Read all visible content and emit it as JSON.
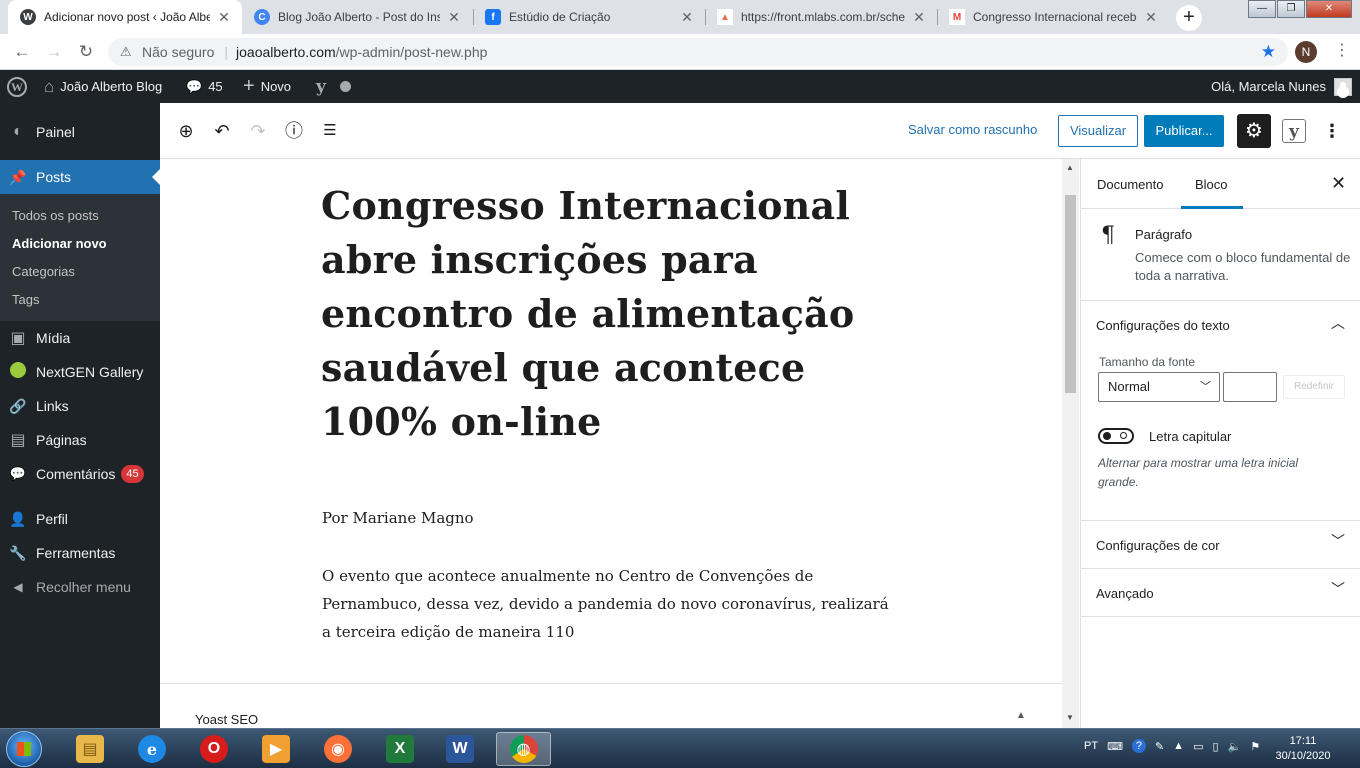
{
  "browser": {
    "tabs": [
      {
        "title": "Adicionar novo post ‹ João Albe",
        "favicon_color": "#3c4043",
        "favicon_letter": "W",
        "active": true
      },
      {
        "title": "Blog João Alberto - Post do Inst",
        "favicon_color": "#4285f4",
        "favicon_letter": "C",
        "active": false
      },
      {
        "title": "Estúdio de Criação",
        "favicon_color": "#1877f2",
        "favicon_letter": "f",
        "active": false
      },
      {
        "title": "https://front.mlabs.com.br/sche",
        "favicon_color": "#f4a261",
        "favicon_letter": "▲",
        "active": false
      },
      {
        "title": "Congresso Internacional recebe",
        "favicon_color": "#ea4335",
        "favicon_letter": "M",
        "active": false
      }
    ],
    "tab_close": "✕",
    "new_tab": "+",
    "window_controls": {
      "minimize": "—",
      "maximize": "❐",
      "close": "✕"
    },
    "nav": {
      "back": "←",
      "forward": "→",
      "reload": "↻"
    },
    "security_icon": "⚠",
    "security_text": "Não seguro",
    "url_host": "joaoalberto.com",
    "url_path": "/wp-admin/post-new.php",
    "bookmark_icon": "★",
    "profile_initial": "N",
    "menu_icon": "⋮"
  },
  "adminbar": {
    "wp_logo": "W",
    "site_icon": "⌂",
    "site_name": "João Alberto Blog",
    "comments_icon": "💬",
    "comments_count": "45",
    "new_icon": "+",
    "new_label": "Novo",
    "yoast_icon": "y",
    "greeting": "Olá, Marcela Nunes"
  },
  "sidebar": {
    "items": [
      {
        "label": "Painel",
        "icon": "◐"
      },
      {
        "label": "Posts",
        "icon": "📌"
      },
      {
        "label": "Mídia",
        "icon": "▣"
      },
      {
        "label": "NextGEN Gallery",
        "icon": "●"
      },
      {
        "label": "Links",
        "icon": "🔗"
      },
      {
        "label": "Páginas",
        "icon": "▤"
      },
      {
        "label": "Comentários",
        "icon": "💬",
        "badge": "45"
      },
      {
        "label": "Perfil",
        "icon": "👤"
      },
      {
        "label": "Ferramentas",
        "icon": "🔧"
      },
      {
        "label": "Recolher menu",
        "icon": "◀"
      }
    ],
    "posts_submenu": [
      "Todos os posts",
      "Adicionar novo",
      "Categorias",
      "Tags"
    ]
  },
  "toolbar": {
    "add_icon": "⊕",
    "undo_icon": "↶",
    "redo_icon": "↷",
    "info_icon": "ⓘ",
    "outline_icon": "☰",
    "save_draft": "Salvar como rascunho",
    "preview": "Visualizar",
    "publish": "Publicar...",
    "settings_icon": "⚙",
    "yoast_icon": "y",
    "more_icon": "⋮"
  },
  "post": {
    "title": "Congresso Internacional abre inscrições para encontro de alimentação saudável que acontece 100% on-line",
    "byline": "Por Mariane Magno",
    "paragraph": "O evento que acontece anualmente no Centro de Convenções de Pernambuco, dessa vez, devido a pandemia do novo coronavírus, realizará a terceira edição de maneira 110"
  },
  "metabox": {
    "yoast_label": "Yoast SEO",
    "caret": "▲"
  },
  "settings_sidebar": {
    "tab_document": "Documento",
    "tab_block": "Bloco",
    "close_icon": "✕",
    "block_icon": "¶",
    "block_name": "Parágrafo",
    "block_description": "Comece com o bloco fundamental de toda a narrativa.",
    "text_settings": "Configurações do texto",
    "font_size_label": "Tamanho da fonte",
    "font_size_value": "Normal",
    "reset": "Redefinir",
    "drop_cap_label": "Letra capitular",
    "drop_cap_help": "Alternar para mostrar uma letra inicial grande.",
    "color_settings": "Configurações de cor",
    "advanced": "Avançado",
    "chevron_up": "︿",
    "chevron_down": "﹀"
  },
  "taskbar": {
    "apps": [
      {
        "name": "explorer",
        "color": "#e8b84a",
        "glyph": "▤"
      },
      {
        "name": "internet-explorer",
        "color": "#1e88e5",
        "glyph": "e"
      },
      {
        "name": "opera",
        "color": "#d81b1b",
        "glyph": "O"
      },
      {
        "name": "media-player",
        "color": "#f0a030",
        "glyph": "▶"
      },
      {
        "name": "firefox",
        "color": "#ff7139",
        "glyph": "◉"
      },
      {
        "name": "excel",
        "color": "#1f7a3c",
        "glyph": "X"
      },
      {
        "name": "word",
        "color": "#2b579a",
        "glyph": "W"
      },
      {
        "name": "chrome",
        "color": "#4caf50",
        "glyph": "◍"
      }
    ],
    "language": "PT",
    "time": "17:11",
    "date": "30/10/2020"
  }
}
